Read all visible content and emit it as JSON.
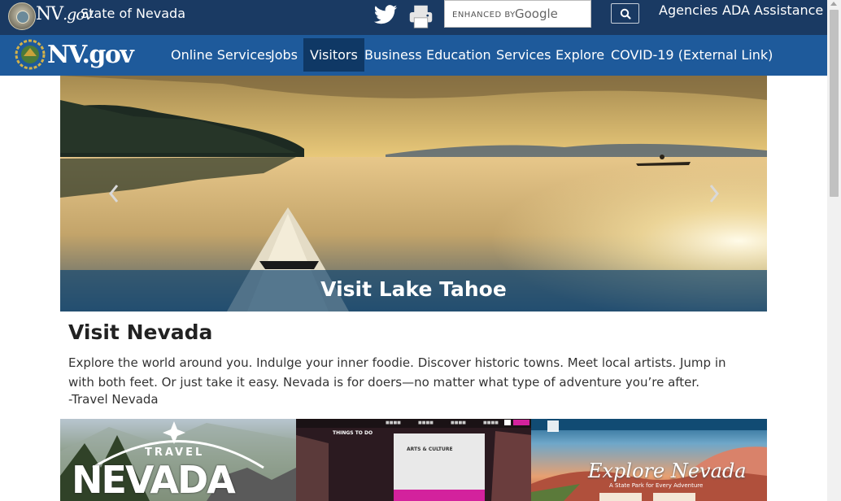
{
  "topbar": {
    "brand": "NV",
    "brand_suffix": ".gov",
    "state_label": "State of Nevada",
    "search": {
      "prefix": "ENHANCED BY",
      "engine": "Google",
      "button_icon": "search-icon"
    },
    "links": [
      "Agencies",
      "ADA Assistance"
    ],
    "icons": [
      "twitter-icon",
      "print-icon"
    ]
  },
  "navbar": {
    "brand": "NV",
    "brand_suffix": ".gov",
    "items": [
      {
        "label": "Online Services",
        "active": false
      },
      {
        "label": "Jobs",
        "active": false
      },
      {
        "label": "Visitors",
        "active": true
      },
      {
        "label": "Business",
        "active": false
      },
      {
        "label": "Education",
        "active": false
      },
      {
        "label": "Services",
        "active": false
      },
      {
        "label": "Explore",
        "active": false
      },
      {
        "label": "COVID-19 (External Link)",
        "active": false
      }
    ]
  },
  "carousel": {
    "caption": "Visit Lake Tahoe",
    "prev_icon": "chevron-left-icon",
    "next_icon": "chevron-right-icon"
  },
  "intro": {
    "title": "Visit Nevada",
    "body": "Explore the world around you. Indulge your inner foodie. Discover historic towns. Meet local artists. Jump in with both feet. Or just take it easy. Nevada is for doers—no matter what type of adventure you’re after.",
    "cite": "-Travel Nevada"
  },
  "thumbnails": [
    {
      "big": "NEVADA",
      "arc": "TRAVEL"
    },
    {
      "heading": "THINGS TO DO",
      "card_title": "ARTS & CULTURE"
    },
    {
      "script": "Explore Nevada",
      "sub": "A State Park for Every Adventure"
    }
  ],
  "colors": {
    "topbar": "#1a3a63",
    "navbar": "#1e5a9b",
    "nav_active": "#0f3865",
    "caption_bar": "#184a72"
  }
}
